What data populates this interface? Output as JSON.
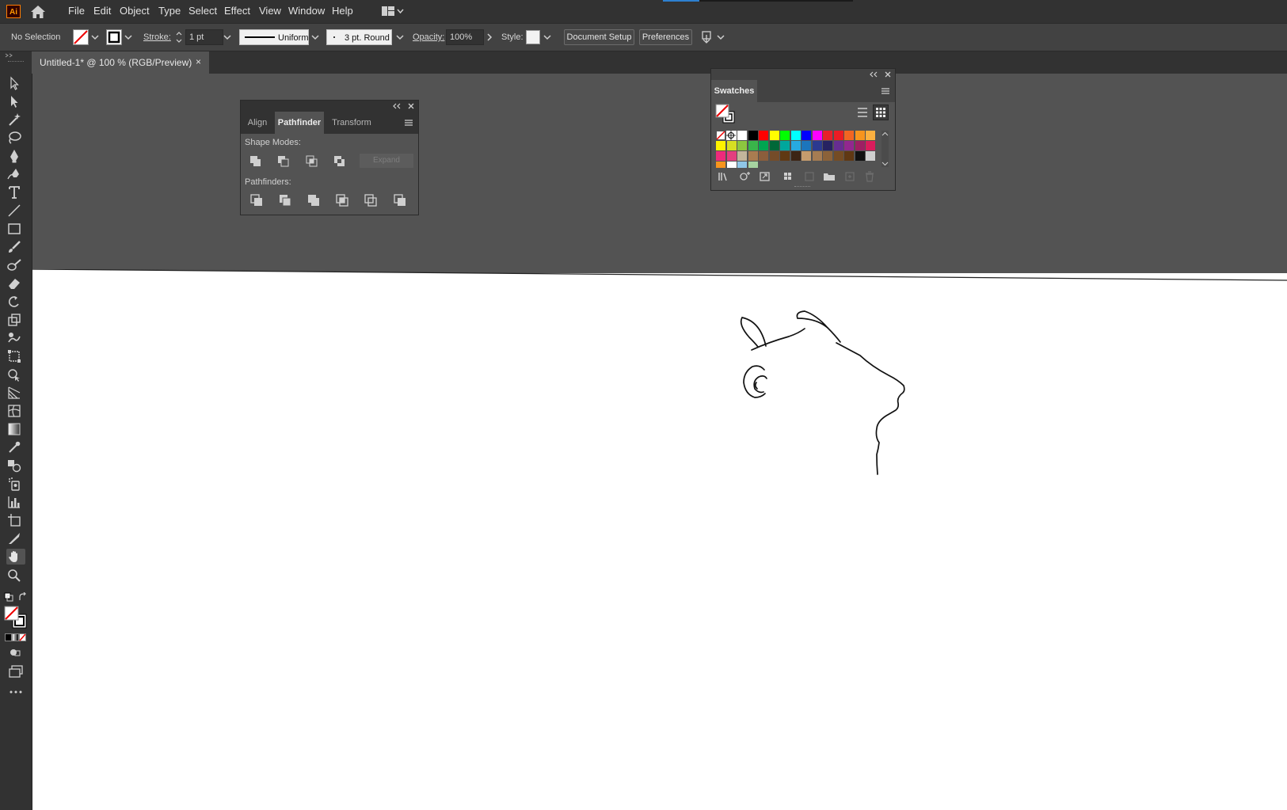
{
  "app": {
    "logo": "Ai",
    "menu": [
      "File",
      "Edit",
      "Object",
      "Type",
      "Select",
      "Effect",
      "View",
      "Window",
      "Help"
    ]
  },
  "control": {
    "selection": "No Selection",
    "stroke_label": "Stroke:",
    "stroke_weight": "1 pt",
    "stroke_profile": "Uniform",
    "brush": "3 pt. Round",
    "opacity_label": "Opacity:",
    "opacity": "100%",
    "style_label": "Style:",
    "document_setup": "Document Setup",
    "preferences": "Preferences"
  },
  "document": {
    "tab_title": "Untitled-1* @ 100 % (RGB/Preview)",
    "close": "×"
  },
  "pathfinder_panel": {
    "tabs": [
      "Align",
      "Pathfinder",
      "Transform"
    ],
    "active_tab": "Pathfinder",
    "shape_modes_label": "Shape Modes:",
    "expand_label": "Expand",
    "pathfinders_label": "Pathfinders:"
  },
  "swatches_panel": {
    "tab": "Swatches",
    "colors": [
      [
        "#ffffff",
        "#ffffff",
        "#ffffff",
        "#000000",
        "#ff0000",
        "#ffff00",
        "#00ff00",
        "#00ffff",
        "#0000ff",
        "#ff00ff",
        "#e8202a",
        "#ec1c24",
        "#f26522",
        "#f7941d",
        "#fbb040"
      ],
      [
        "#fff200",
        "#d7df23",
        "#8dc63f",
        "#39b54a",
        "#00a651",
        "#006838",
        "#00a79d",
        "#27aae1",
        "#1c75bc",
        "#2b3990",
        "#262262",
        "#662d91",
        "#92278f",
        "#9e1f63",
        "#da1c5c"
      ],
      [
        "#ee2a7b",
        "#e33e7f",
        "#c2b59b",
        "#a97c50",
        "#8b5e3c",
        "#754c29",
        "#603913",
        "#3c2415",
        "#c69c6d",
        "#a67c52",
        "#8c6239",
        "#754c24",
        "#603813",
        "#111111",
        "#cfcfcf"
      ],
      [
        "#f7941d",
        "#ffffff",
        "#8fc7e8",
        "#a6d3a0"
      ]
    ]
  },
  "colors": {
    "menubar": "#323232",
    "controlbar": "#424242",
    "workspace": "#535353",
    "artboard": "#ffffff"
  }
}
